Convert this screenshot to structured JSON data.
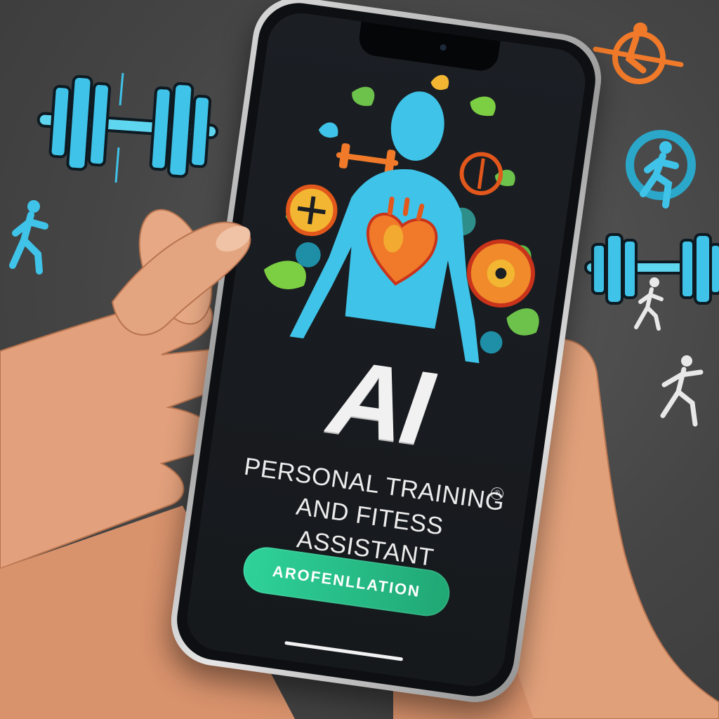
{
  "app": {
    "hero_title": "AI",
    "subtitle_line1": "PERSONAL TRAINING",
    "subtitle_line2": "AND FITESS ASSISTANT",
    "trademark_symbol": "®",
    "cta_label": "AROFENLLATION"
  },
  "icons": {
    "background": [
      "dumbbell-icon",
      "running-person-icon",
      "target-person-icon",
      "dumbbell-icon",
      "runner-icon",
      "walking-person-icon",
      "exercise-person-icon"
    ],
    "artwork": [
      "human-silhouette-icon",
      "heart-icon",
      "compass-icon",
      "dumbbell-icon",
      "leaf-icon",
      "plus-medal-icon"
    ]
  },
  "colors": {
    "accent_blue": "#3fc3e8",
    "accent_green": "#2bc98d",
    "accent_orange": "#f07a2a",
    "screen_bg": "#1b1f24",
    "background": "#4a4a4a"
  }
}
